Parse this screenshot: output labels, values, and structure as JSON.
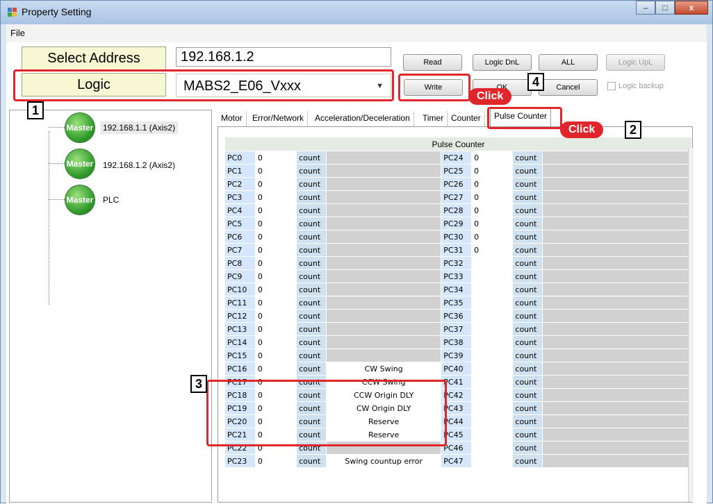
{
  "window": {
    "title": "Property Setting",
    "min": "–",
    "max": "□",
    "close": "x"
  },
  "menu": {
    "file": "File"
  },
  "address": {
    "label": "Select Address",
    "value": "192.168.1.2"
  },
  "logic": {
    "label": "Logic",
    "value": "MABS2_E06_Vxxx",
    "arrow": "▼"
  },
  "buttons": {
    "read": "Read",
    "logic_dnl": "Logic DnL",
    "all": "ALL",
    "logic_upl": "Logic UpL",
    "write": "Write",
    "ok": "OK",
    "cancel": "Cancel",
    "logic_backup": "Logic backup"
  },
  "callouts": {
    "n1": "1",
    "n2": "2",
    "n3": "3",
    "n4": "4",
    "click": "Click"
  },
  "tree": {
    "icon_text": "Master",
    "nodes": [
      {
        "label": "192.168.1.1 (Axis2)"
      },
      {
        "label": "192.168.1.2 (Axis2)"
      },
      {
        "label": "PLC"
      }
    ]
  },
  "tabs": [
    "Motor",
    "Error/Network",
    "Acceleration/Deceleration",
    "Timer",
    "Counter",
    "Pulse Counter"
  ],
  "pulse_table": {
    "header": "Pulse Counter",
    "unit": "count",
    "rows": [
      {
        "left": "PC0",
        "lval": "0",
        "desc": "",
        "right": "PC24",
        "rval": "0"
      },
      {
        "left": "PC1",
        "lval": "0",
        "desc": "",
        "right": "PC25",
        "rval": "0"
      },
      {
        "left": "PC2",
        "lval": "0",
        "desc": "",
        "right": "PC26",
        "rval": "0"
      },
      {
        "left": "PC3",
        "lval": "0",
        "desc": "",
        "right": "PC27",
        "rval": "0"
      },
      {
        "left": "PC4",
        "lval": "0",
        "desc": "",
        "right": "PC28",
        "rval": "0"
      },
      {
        "left": "PC5",
        "lval": "0",
        "desc": "",
        "right": "PC29",
        "rval": "0"
      },
      {
        "left": "PC6",
        "lval": "0",
        "desc": "",
        "right": "PC30",
        "rval": "0"
      },
      {
        "left": "PC7",
        "lval": "0",
        "desc": "",
        "right": "PC31",
        "rval": "0"
      },
      {
        "left": "PC8",
        "lval": "0",
        "desc": "",
        "right": "PC32",
        "rval": ""
      },
      {
        "left": "PC9",
        "lval": "0",
        "desc": "",
        "right": "PC33",
        "rval": ""
      },
      {
        "left": "PC10",
        "lval": "0",
        "desc": "",
        "right": "PC34",
        "rval": ""
      },
      {
        "left": "PC11",
        "lval": "0",
        "desc": "",
        "right": "PC35",
        "rval": ""
      },
      {
        "left": "PC12",
        "lval": "0",
        "desc": "",
        "right": "PC36",
        "rval": ""
      },
      {
        "left": "PC13",
        "lval": "0",
        "desc": "",
        "right": "PC37",
        "rval": ""
      },
      {
        "left": "PC14",
        "lval": "0",
        "desc": "",
        "right": "PC38",
        "rval": ""
      },
      {
        "left": "PC15",
        "lval": "0",
        "desc": "",
        "right": "PC39",
        "rval": ""
      },
      {
        "left": "PC16",
        "lval": "0",
        "desc": "CW Swing",
        "right": "PC40",
        "rval": ""
      },
      {
        "left": "PC17",
        "lval": "0",
        "desc": "CCW Swing",
        "right": "PC41",
        "rval": ""
      },
      {
        "left": "PC18",
        "lval": "0",
        "desc": "CCW Origin DLY",
        "right": "PC42",
        "rval": ""
      },
      {
        "left": "PC19",
        "lval": "0",
        "desc": "CW Origin DLY",
        "right": "PC43",
        "rval": ""
      },
      {
        "left": "PC20",
        "lval": "0",
        "desc": "Reserve",
        "right": "PC44",
        "rval": ""
      },
      {
        "left": "PC21",
        "lval": "0",
        "desc": "Reserve",
        "right": "PC45",
        "rval": ""
      },
      {
        "left": "PC22",
        "lval": "0",
        "desc": "",
        "right": "PC46",
        "rval": ""
      },
      {
        "left": "PC23",
        "lval": "0",
        "desc": "Swing countup error",
        "right": "PC47",
        "rval": ""
      }
    ]
  },
  "colors": {
    "accent_red": "#e0252b",
    "label_bg": "#f7f7d4",
    "master_green": "#2e9a2a"
  }
}
